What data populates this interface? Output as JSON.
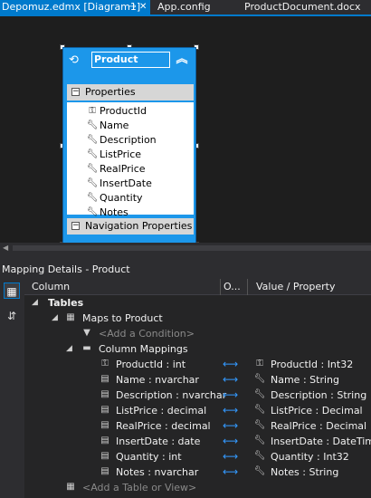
{
  "tabs": [
    {
      "label": "Depomuz.edmx [Diagram1]",
      "active": true
    },
    {
      "label": "App.config",
      "active": false
    },
    {
      "label": "ProductDocument.docx",
      "active": false
    }
  ],
  "designer": {
    "entity": {
      "name": "Product",
      "properties_header": "Properties",
      "properties": [
        {
          "name": "ProductId",
          "icon": "key-icon"
        },
        {
          "name": "Name",
          "icon": "wrench-icon"
        },
        {
          "name": "Description",
          "icon": "wrench-icon"
        },
        {
          "name": "ListPrice",
          "icon": "wrench-icon"
        },
        {
          "name": "RealPrice",
          "icon": "wrench-icon"
        },
        {
          "name": "InsertDate",
          "icon": "wrench-icon"
        },
        {
          "name": "Quantity",
          "icon": "wrench-icon"
        },
        {
          "name": "Notes",
          "icon": "wrench-icon"
        }
      ],
      "navigation_header": "Navigation Properties"
    }
  },
  "mapping": {
    "title": "Mapping Details - Product",
    "columns": {
      "column": "Column",
      "operator": "O...",
      "value": "Value / Property"
    },
    "tables_label": "Tables",
    "maps_to": "Maps to Product",
    "add_condition": "<Add a Condition>",
    "column_mappings_label": "Column Mappings",
    "rows": [
      {
        "column": "ProductId : int",
        "property": "ProductId : Int32",
        "key": true
      },
      {
        "column": "Name : nvarchar",
        "property": "Name : String",
        "key": false
      },
      {
        "column": "Description : nvarchar",
        "property": "Description : String",
        "key": false
      },
      {
        "column": "ListPrice : decimal",
        "property": "ListPrice : Decimal",
        "key": false
      },
      {
        "column": "RealPrice : decimal",
        "property": "RealPrice : Decimal",
        "key": false
      },
      {
        "column": "InsertDate : date",
        "property": "InsertDate : DateTime",
        "key": false
      },
      {
        "column": "Quantity : int",
        "property": "Quantity : Int32",
        "key": false
      },
      {
        "column": "Notes : nvarchar",
        "property": "Notes : String",
        "key": false
      }
    ],
    "add_table": "<Add a Table or View>"
  },
  "colors": {
    "accent": "#007acc",
    "entity": "#1c97ea",
    "background": "#1e1e1e"
  }
}
